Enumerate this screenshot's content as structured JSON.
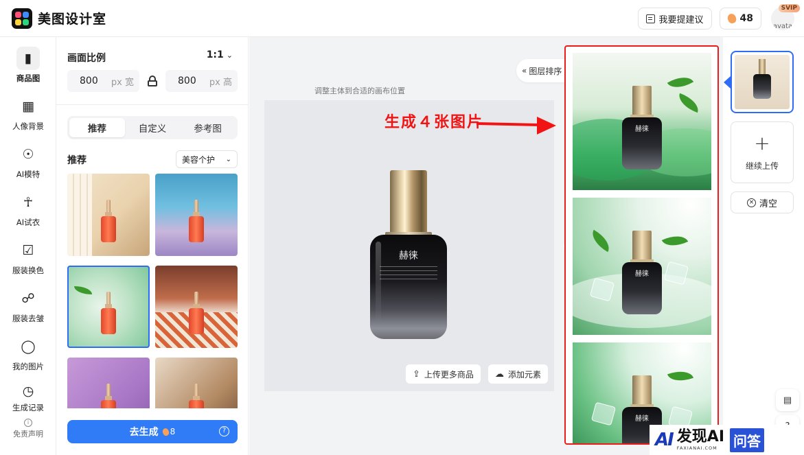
{
  "app": {
    "name": "美图设计室"
  },
  "header": {
    "suggest_label": "我要提建议",
    "credits": "48",
    "avatar_alt": "avata",
    "vip_badge": "SVIP"
  },
  "nav": {
    "items": [
      {
        "label": "商品图",
        "icon": "product-icon"
      },
      {
        "label": "人像背景",
        "icon": "portrait-bg-icon"
      },
      {
        "label": "AI模特",
        "icon": "ai-model-icon"
      },
      {
        "label": "AI试衣",
        "icon": "try-on-icon"
      },
      {
        "label": "服装换色",
        "icon": "recolor-icon"
      },
      {
        "label": "服装去皱",
        "icon": "dewrinkle-icon"
      },
      {
        "label": "我的图片",
        "icon": "my-images-icon"
      },
      {
        "label": "生成记录",
        "icon": "history-icon"
      }
    ],
    "disclaimer": "免责声明"
  },
  "panel": {
    "ratio_title": "画面比例",
    "ratio_value": "1:1",
    "width_value": "800",
    "width_unit": "px 宽",
    "height_value": "800",
    "height_unit": "px 高",
    "tabs": [
      "推荐",
      "自定义",
      "参考图"
    ],
    "section_title": "推荐",
    "category": "美容个护",
    "generate_label": "去生成",
    "generate_cost": "8"
  },
  "canvas": {
    "hint": "调整主体到合适的画布位置",
    "layer_sort": "图层排序",
    "upload_more": "上传更多商品",
    "add_element": "添加元素",
    "bottle_label": "赫徕"
  },
  "annotation": {
    "text": "生成４张图片",
    "color": "#f01414"
  },
  "results": {
    "count_visible": 3,
    "bottle_label": "赫徕"
  },
  "right": {
    "continue_upload": "继续上传",
    "clear": "清空",
    "tool_question": "?"
  },
  "watermark": {
    "logo": "AI",
    "title": "发现AI",
    "subtitle": "FAXIANAI.COM",
    "badge": "问答"
  },
  "colors": {
    "accent": "#2f7cf6",
    "annotation": "#f01414",
    "selected_outline": "#2f6cf6"
  }
}
